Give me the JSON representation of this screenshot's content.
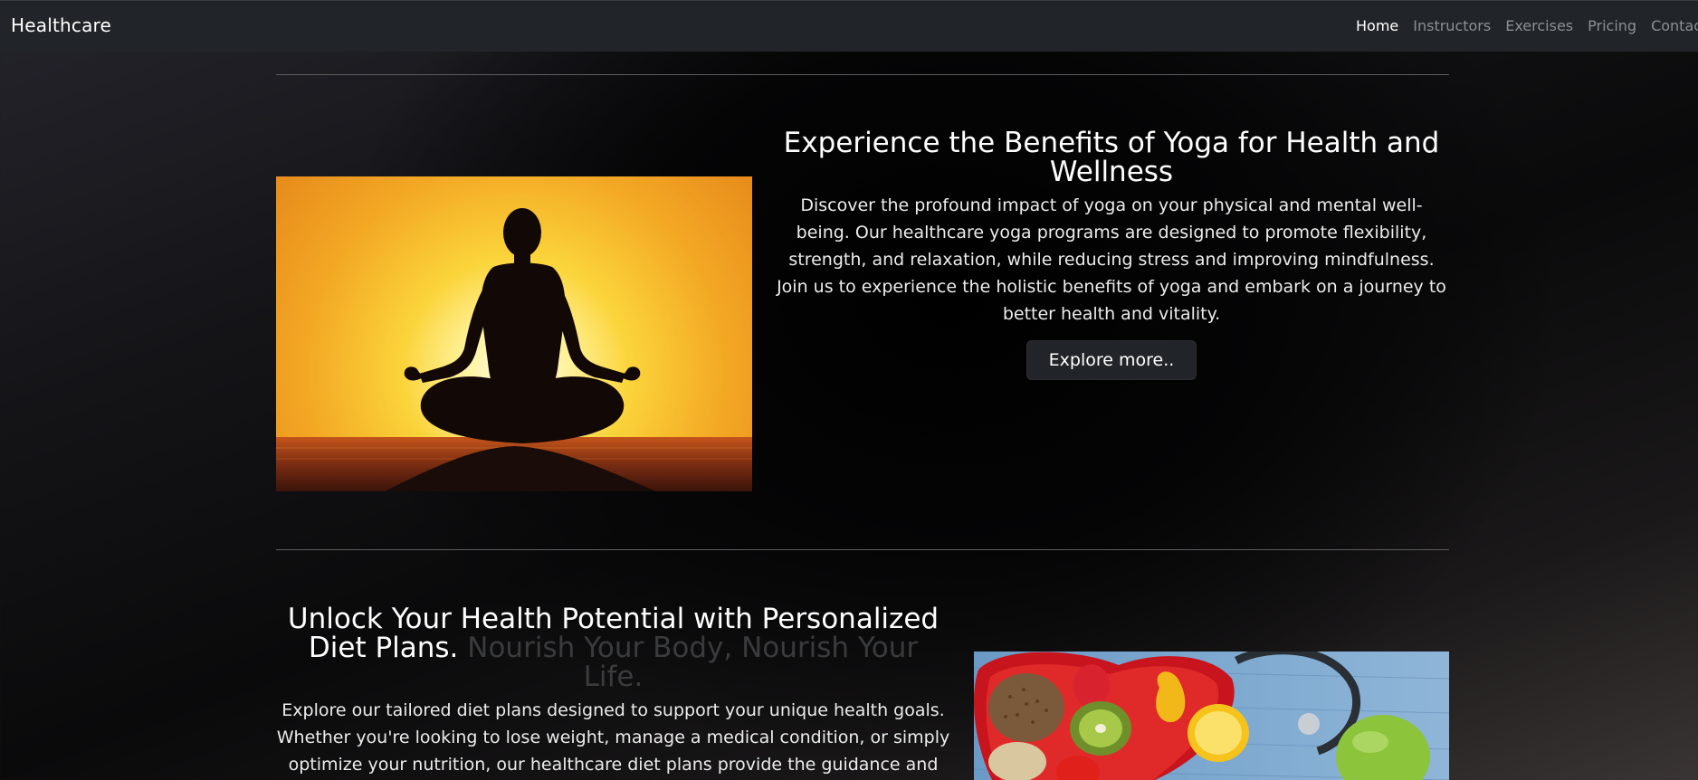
{
  "navbar": {
    "brand": "Healthcare",
    "links": [
      {
        "label": "Home",
        "active": true
      },
      {
        "label": "Instructors",
        "active": false
      },
      {
        "label": "Exercises",
        "active": false
      },
      {
        "label": "Pricing",
        "active": false
      },
      {
        "label": "Contact",
        "active": false
      }
    ]
  },
  "yoga_section": {
    "heading": "Experience the Benefits of Yoga for Health and Wellness",
    "body": "Discover the profound impact of yoga on your physical and mental well-being. Our healthcare yoga programs are designed to promote flexibility, strength, and relaxation, while reducing stress and improving mindfulness. Join us to experience the holistic benefits of yoga and embark on a journey to better health and vitality.",
    "button_label": "Explore more.."
  },
  "diet_section": {
    "heading": "Unlock Your Health Potential with Personalized Diet Plans.",
    "heading_dim": "Nourish Your Body, Nourish Your Life.",
    "body": "Explore our tailored diet plans designed to support your unique health goals. Whether you're looking to lose weight, manage a medical condition, or simply optimize your nutrition, our healthcare diet plans provide the guidance and support you need. Let us help you achieve optimal health"
  },
  "colors": {
    "navbar_bg": "#212529",
    "nav_link": "#8c8f93",
    "nav_link_active": "#ffffff",
    "button_bg": "#212529"
  }
}
